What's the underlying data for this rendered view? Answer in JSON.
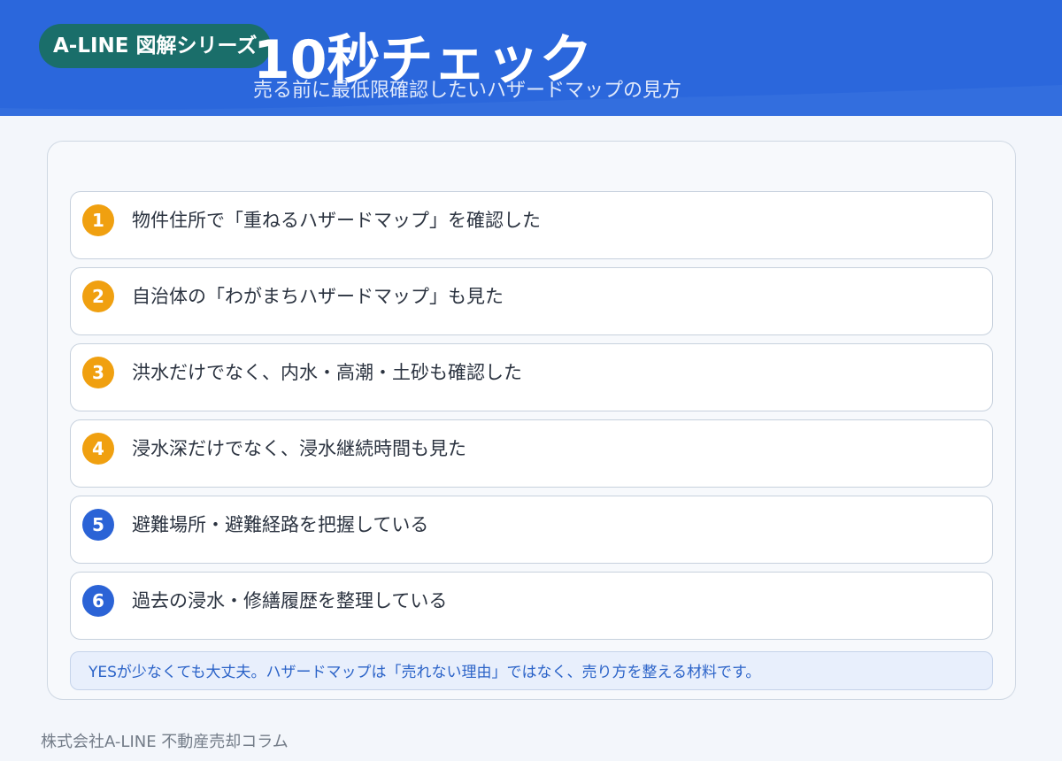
{
  "header": {
    "series_badge": "A-LINE 図解シリーズ",
    "title": "10秒チェック",
    "subtitle": "売る前に最低限確認したいハザードマップの見方"
  },
  "checklist": {
    "items": [
      {
        "number": "1",
        "text": "物件住所で「重ねるハザードマップ」を確認した",
        "badge_color": "#f0a010"
      },
      {
        "number": "2",
        "text": "自治体の「わがまちハザードマップ」も見た",
        "badge_color": "#f0a010"
      },
      {
        "number": "3",
        "text": "洪水だけでなく、内水・高潮・土砂も確認した",
        "badge_color": "#f0a010"
      },
      {
        "number": "4",
        "text": "浸水深だけでなく、浸水継続時間も見た",
        "badge_color": "#f0a010"
      },
      {
        "number": "5",
        "text": "避難場所・避難経路を把握している",
        "badge_color": "#2b63d6"
      },
      {
        "number": "6",
        "text": "過去の浸水・修繕履歴を整理している",
        "badge_color": "#2b63d6"
      }
    ],
    "note": "YESが少なくても大丈夫。ハザードマップは「売れない理由」ではなく、売り方を整える材料です。"
  },
  "footer": {
    "text": "株式会社A-LINE 不動産売却コラム"
  },
  "colors": {
    "header_bg": "#2b67dc",
    "badge_bg": "#1a6e6a",
    "accent_orange": "#f0a010",
    "accent_blue": "#2b63d6",
    "note_text": "#2b63c8"
  }
}
